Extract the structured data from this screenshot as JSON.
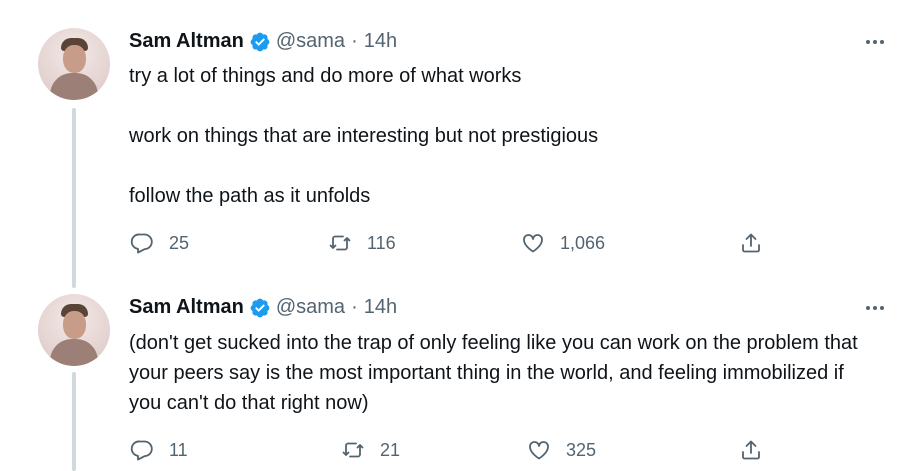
{
  "tweets": [
    {
      "author_name": "Sam Altman",
      "handle": "@sama",
      "separator": "·",
      "time": "14h",
      "text": "try a lot of things and do more of what works\n\nwork on things that are interesting but not prestigious\n\nfollow the path as it unfolds",
      "replies": "25",
      "retweets": "116",
      "likes": "1,066"
    },
    {
      "author_name": "Sam Altman",
      "handle": "@sama",
      "separator": "·",
      "time": "14h",
      "text": "(don't get sucked into the trap of only feeling like you can work on the problem that your peers say is the most important thing in the world, and feeling immobilized if you can't do that right now)",
      "replies": "11",
      "retweets": "21",
      "likes": "325"
    }
  ],
  "icons": {
    "reply": "reply-icon",
    "retweet": "retweet-icon",
    "like": "heart-icon",
    "share": "share-icon",
    "verified": "verified-badge-icon",
    "more": "more-options-icon"
  },
  "colors": {
    "text": "#0f1419",
    "secondary": "#536471",
    "verified": "#1d9bf0",
    "thread_line": "#cfd9de"
  }
}
